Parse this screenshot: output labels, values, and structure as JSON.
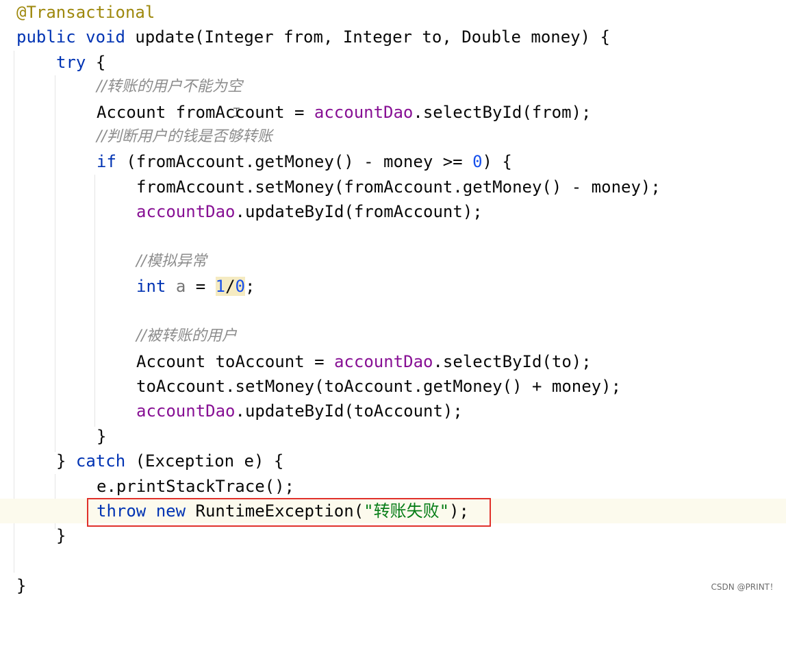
{
  "editor": {
    "lines": {
      "l1_annotation": "@Transactional",
      "l2_public": "public",
      "l2_void": "void",
      "l2_rest": "update(Integer from, Integer to, Double money) {",
      "l3_try": "try",
      "l3_brace": "{",
      "l4_comment": "//转账的用户不能为空",
      "l5_a": "Account fromAccount = ",
      "l5_field": "accountDao",
      "l5_b": ".selectById(from);",
      "l6_comment": "//判断用户的钱是否够转账",
      "l7_if": "if",
      "l7_a": " (fromAccount.getMoney() - money >= ",
      "l7_num": "0",
      "l7_b": ") {",
      "l8": "fromAccount.setMoney(fromAccount.getMoney() - money);",
      "l9_field": "accountDao",
      "l9_b": ".updateById(fromAccount);",
      "l11_comment": "//模拟异常",
      "l12_int": "int",
      "l12_var": "a",
      "l12_eq": " = ",
      "l12_num1": "1",
      "l12_slash": "/",
      "l12_num2": "0",
      "l12_semi": ";",
      "l14_comment": "//被转账的用户",
      "l15_a": "Account toAccount = ",
      "l15_field": "accountDao",
      "l15_b": ".selectById(to);",
      "l16": "toAccount.setMoney(toAccount.getMoney() + money);",
      "l17_field": "accountDao",
      "l17_b": ".updateById(toAccount);",
      "l18": "}",
      "l19_a": "} ",
      "l19_catch": "catch",
      "l19_b": " (Exception e) {",
      "l20": "e.printStackTrace();",
      "l21_throw": "throw",
      "l21_new": "new",
      "l21_a": " RuntimeException(",
      "l21_str": "\"转账失败\"",
      "l21_b": ");",
      "l22": "}",
      "l24": "}"
    }
  },
  "watermark": "CSDN @PRINT！",
  "colors": {
    "keyword": "#0033b3",
    "annotation": "#9e880d",
    "field": "#871094",
    "number": "#1750eb",
    "comment": "#8c8c8c",
    "string": "#067d17",
    "highlight_border": "#e0302a"
  },
  "icons": {
    "text_cursor": "i-beam-cursor-icon"
  }
}
